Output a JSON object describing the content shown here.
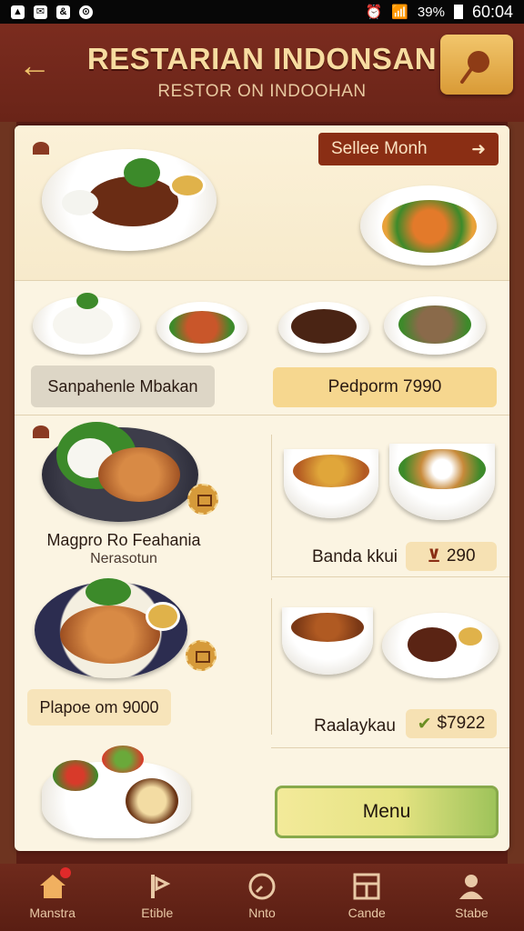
{
  "status": {
    "battery": "39%",
    "time": "60:04"
  },
  "header": {
    "title": "RESTARIAN INDONSAN",
    "subtitle": "RESTOR ON INDOOHAN"
  },
  "select_month": {
    "label": "Sellee Monh",
    "arrow": "➜"
  },
  "labels": {
    "left_card": "Sanpahenle Mbakan",
    "right_card": "Pedporm  7990"
  },
  "dishes": [
    {
      "title": "Magpro Ro Feahania",
      "sub": "Nerasotun"
    },
    {
      "title": "Banda kkui",
      "price": "290"
    },
    {
      "title": "Plapoe om 9000"
    },
    {
      "title": "Raalaykau",
      "price": "$7922"
    }
  ],
  "menu_button": "Menu",
  "nav": [
    {
      "label": "Manstra",
      "icon": "home-icon"
    },
    {
      "label": "Etible",
      "icon": "utensils-icon"
    },
    {
      "label": "Nnto",
      "icon": "clock-icon"
    },
    {
      "label": "Cande",
      "icon": "calendar-icon"
    },
    {
      "label": "Stabe",
      "icon": "user-icon"
    }
  ]
}
